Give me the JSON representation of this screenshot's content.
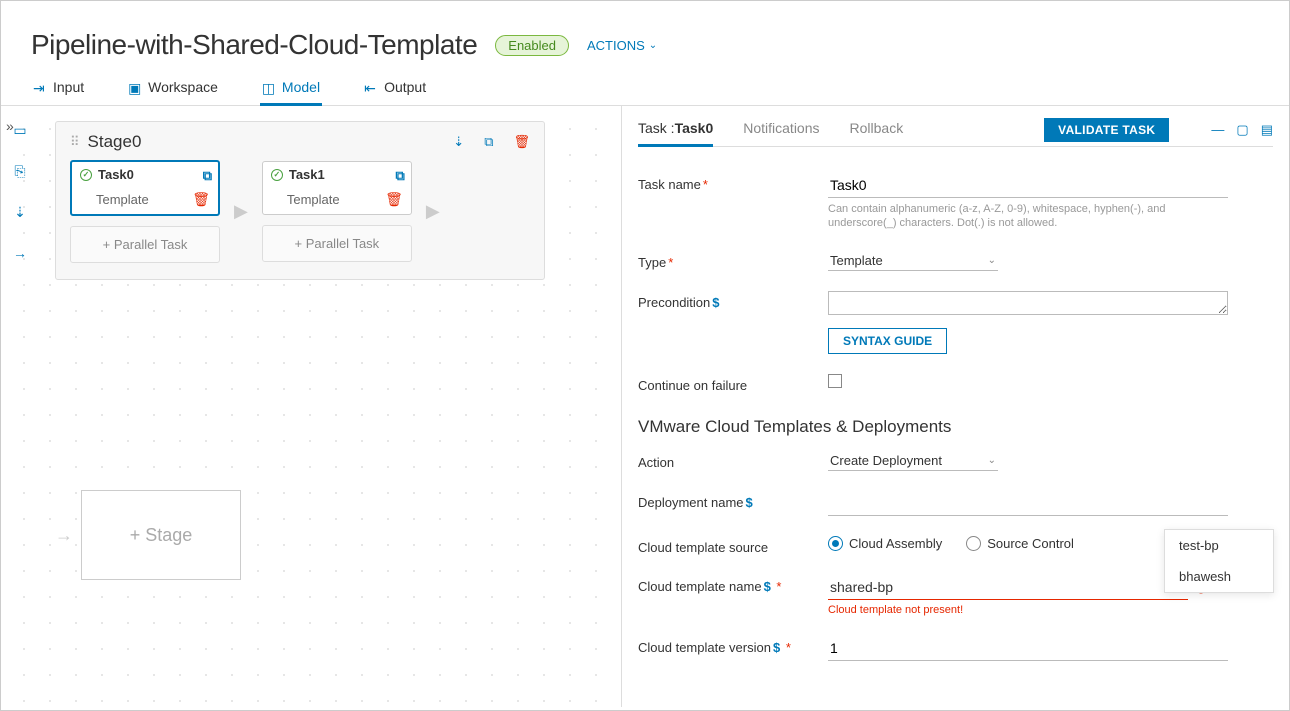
{
  "header": {
    "title": "Pipeline-with-Shared-Cloud-Template",
    "status_badge": "Enabled",
    "actions_label": "ACTIONS"
  },
  "tabs": [
    {
      "id": "input",
      "label": "Input"
    },
    {
      "id": "workspace",
      "label": "Workspace"
    },
    {
      "id": "model",
      "label": "Model",
      "active": true
    },
    {
      "id": "output",
      "label": "Output"
    }
  ],
  "stage": {
    "name": "Stage0",
    "tasks": [
      {
        "name": "Task0",
        "type": "Template",
        "selected": true
      },
      {
        "name": "Task1",
        "type": "Template",
        "selected": false
      }
    ],
    "parallel_label": "Parallel Task",
    "add_stage_label": "Stage"
  },
  "panel": {
    "tab_task_prefix": "Task :",
    "task_name_in_tab": "Task0",
    "tab_notifications": "Notifications",
    "tab_rollback": "Rollback",
    "validate_btn": "VALIDATE TASK"
  },
  "form": {
    "task_name": {
      "label": "Task name",
      "value": "Task0",
      "hint": "Can contain alphanumeric (a-z, A-Z, 0-9), whitespace, hyphen(-), and underscore(_) characters. Dot(.) is not allowed."
    },
    "type": {
      "label": "Type",
      "value": "Template"
    },
    "precondition": {
      "label": "Precondition",
      "value": ""
    },
    "syntax_guide": "SYNTAX GUIDE",
    "continue_on_failure": {
      "label": "Continue on failure",
      "checked": false
    },
    "section_title": "VMware Cloud Templates & Deployments",
    "action": {
      "label": "Action",
      "value": "Create Deployment"
    },
    "deployment_name": {
      "label": "Deployment name",
      "value": ""
    },
    "cloud_template_source": {
      "label": "Cloud template source",
      "options": [
        "Cloud Assembly",
        "Source Control"
      ],
      "selected": "Cloud Assembly"
    },
    "cloud_template_name": {
      "label": "Cloud template name",
      "value": "shared-bp",
      "error": "Cloud template not present!"
    },
    "cloud_template_version": {
      "label": "Cloud template version",
      "value": "1"
    }
  },
  "dropdown": {
    "items": [
      "test-bp",
      "bhawesh"
    ]
  }
}
